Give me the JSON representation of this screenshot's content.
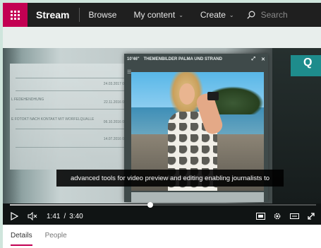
{
  "topbar": {
    "brand": "Stream",
    "nav": [
      {
        "label": "Browse",
        "has_menu": false
      },
      {
        "label": "My content",
        "has_menu": true
      },
      {
        "label": "Create",
        "has_menu": true
      }
    ],
    "search_placeholder": "Search",
    "accent_color": "#c30052"
  },
  "video": {
    "inner_window": {
      "duration": "10'46\"",
      "title": "THEMENBILDER PALMA UND STRAND"
    },
    "background_doc": {
      "rows": [
        {
          "text": "",
          "date": "24.03.2017 0"
        },
        {
          "text": "L FEDEHENDHUNG",
          "date": "22.11.2016 0"
        },
        {
          "text": "E FOTOKT NACH KONTAKT MIT WORFELQUALLE",
          "date": "06.10.2016 0"
        },
        {
          "text": "",
          "date": "14.07.2016 0"
        }
      ]
    },
    "caption": "advanced tools for video preview and editing enabling journalists to",
    "player": {
      "current_time": "1:41",
      "separator": "/",
      "total_time": "3:40",
      "progress_fraction": 0.459
    }
  },
  "tabs": [
    {
      "label": "Details",
      "active": true
    },
    {
      "label": "People",
      "active": false
    }
  ]
}
